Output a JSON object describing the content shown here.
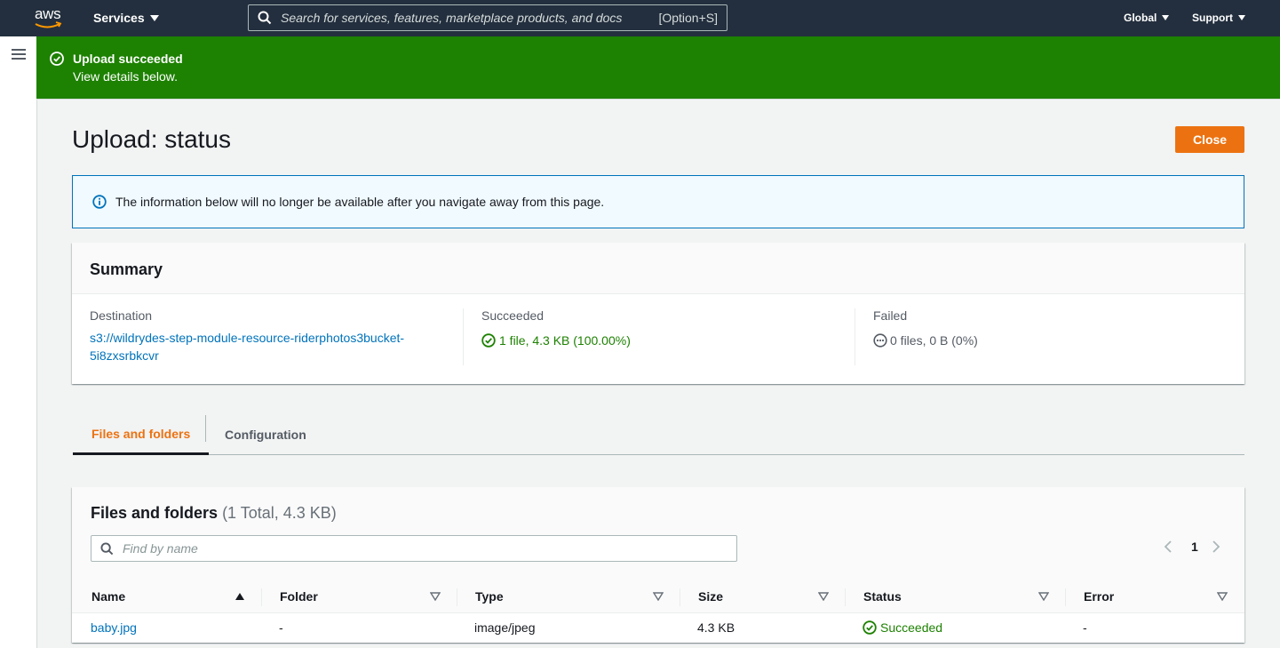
{
  "nav": {
    "logo": "aws",
    "services": "Services",
    "search_placeholder": "Search for services, features, marketplace products, and docs",
    "search_shortcut": "[Option+S]",
    "global": "Global",
    "support": "Support"
  },
  "flash": {
    "title": "Upload succeeded",
    "message": "View details below."
  },
  "page": {
    "title": "Upload: status",
    "close_label": "Close",
    "info": "The information below will no longer be available after you navigate away from this page."
  },
  "summary": {
    "heading": "Summary",
    "destination_label": "Destination",
    "destination_line1": "s3://wildrydes-step-module-resource-riderphotos3bucket-",
    "destination_line2": "5i8zxsrbkcvr",
    "succeeded_label": "Succeeded",
    "succeeded_value": "1 file, 4.3 KB (100.00%)",
    "failed_label": "Failed",
    "failed_value": "0 files, 0 B (0%)"
  },
  "tabs": {
    "files": "Files and folders",
    "config": "Configuration"
  },
  "files": {
    "title": "Files and folders",
    "count": "(1 Total, 4.3 KB)",
    "find_placeholder": "Find by name",
    "page": "1",
    "columns": [
      "Name",
      "Folder",
      "Type",
      "Size",
      "Status",
      "Error"
    ],
    "rows": [
      {
        "name": "baby.jpg",
        "folder": "-",
        "type": "image/jpeg",
        "size": "4.3 KB",
        "status": "Succeeded",
        "error": "-"
      }
    ]
  },
  "colors": {
    "nav_bg": "#232f3e",
    "success": "#1d8102",
    "accent": "#ec7211",
    "link": "#0073bb",
    "info_border": "#0073bb"
  }
}
